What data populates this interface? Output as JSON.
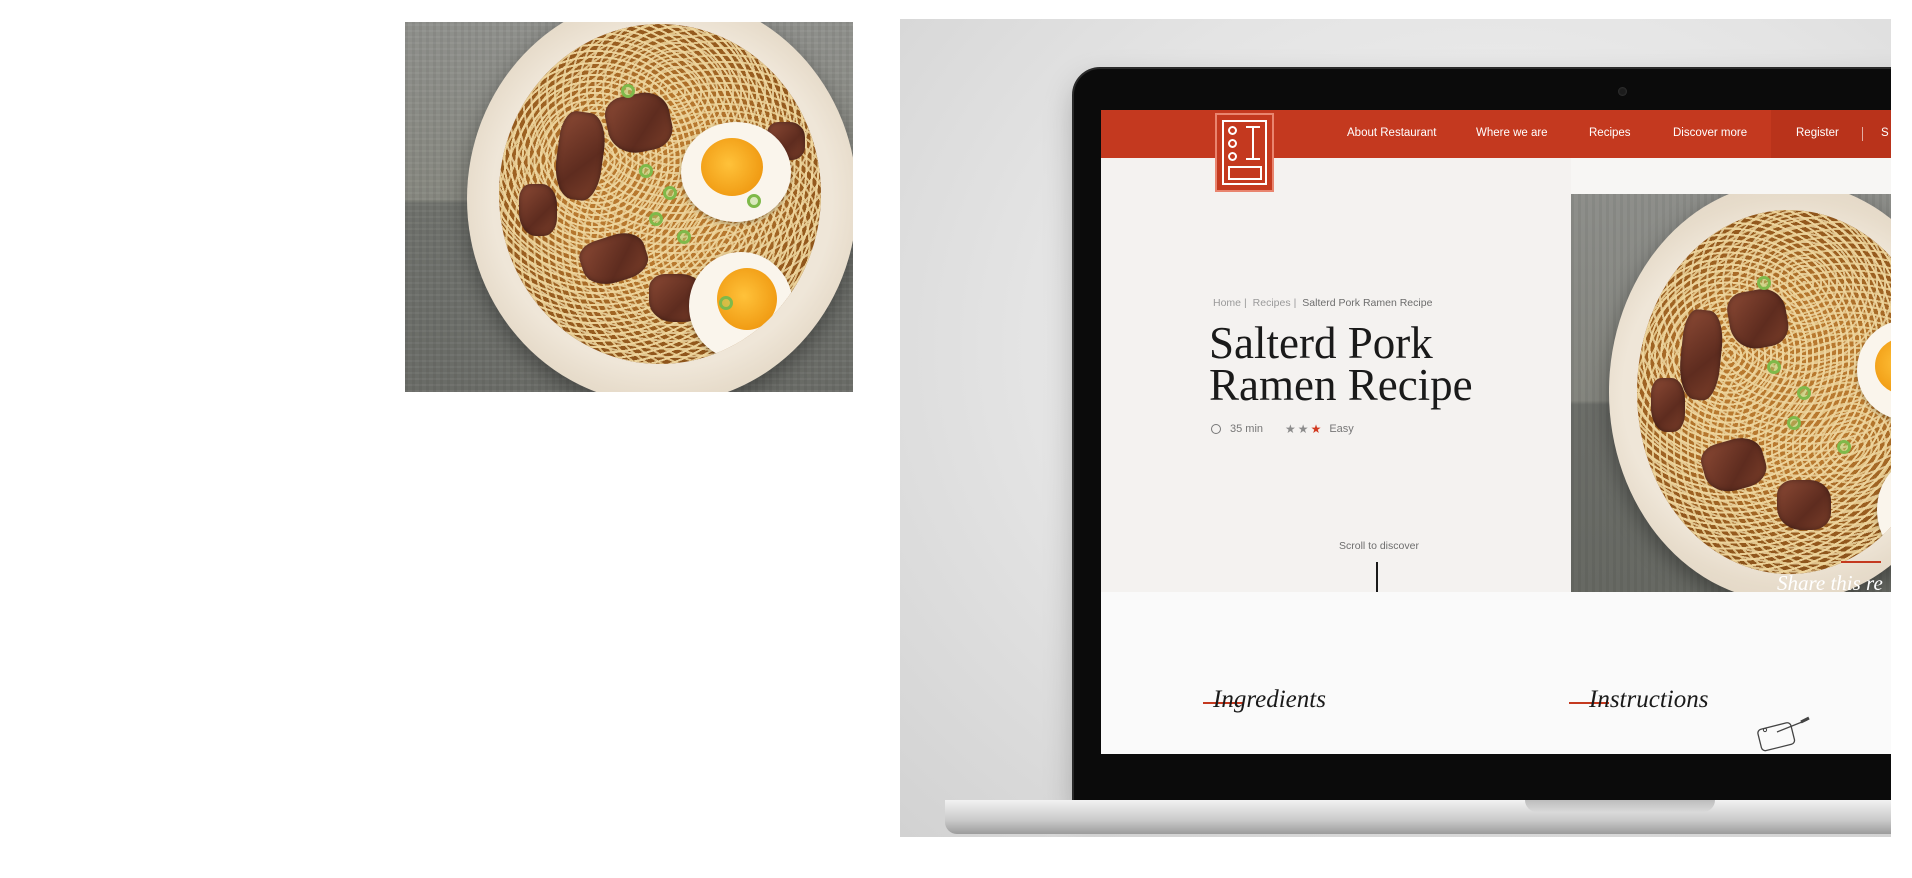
{
  "site": {
    "nav": {
      "items": [
        "About Restaurant",
        "Where we are",
        "Recipes",
        "Discover more"
      ],
      "register_label": "Register",
      "right_cut_label": "S"
    },
    "breadcrumb": {
      "items": [
        "Home",
        "Recipes"
      ],
      "current": "Salterd Pork Ramen Recipe"
    },
    "recipe": {
      "title_line1": "Salterd Pork",
      "title_line2": "Ramen Recipe",
      "time": "35 min",
      "difficulty": "Easy",
      "rating_filled": 3,
      "rating_total": 3
    },
    "scroll_label": "Scroll to discover",
    "share_label": "Share this re",
    "sections": {
      "ingredients": "Ingredients",
      "instructions": "Instructions"
    }
  },
  "colors": {
    "brand_red": "#c4391f",
    "star_gray": "#8c8c8c",
    "star_active": "#d2391f"
  },
  "icons": {
    "time": "clock-icon",
    "logo": "restaurant-logo",
    "board": "cutting-board-icon"
  }
}
